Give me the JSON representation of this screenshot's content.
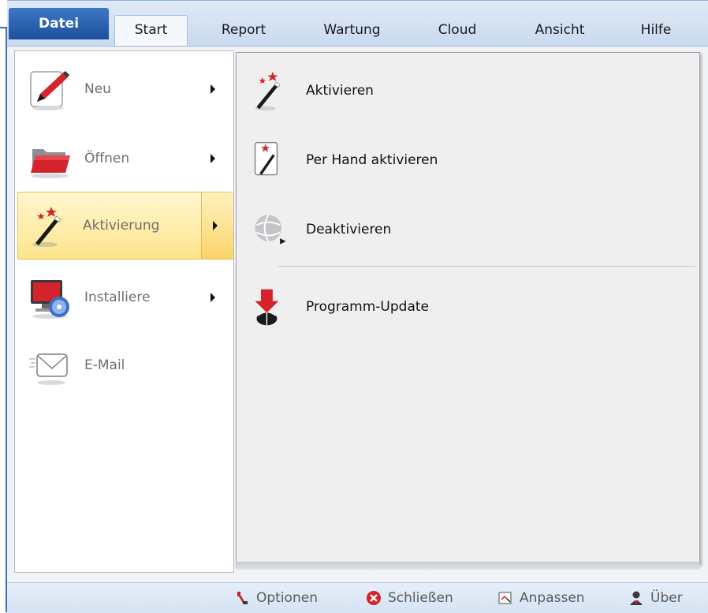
{
  "ribbon": {
    "tabs": [
      {
        "label": "Datei"
      },
      {
        "label": "Start"
      },
      {
        "label": "Report"
      },
      {
        "label": "Wartung"
      },
      {
        "label": "Cloud"
      },
      {
        "label": "Ansicht"
      },
      {
        "label": "Hilfe"
      }
    ]
  },
  "left_menu": {
    "items": [
      {
        "label": "Neu",
        "icon": "pen-icon",
        "submenu": true
      },
      {
        "label": "Öffnen",
        "icon": "folder-icon",
        "submenu": true
      },
      {
        "label": "Aktivierung",
        "icon": "magic-wand-icon",
        "submenu": true,
        "selected": true
      },
      {
        "label": "Installiere",
        "icon": "monitor-disc-icon",
        "submenu": true
      },
      {
        "label": "E-Mail",
        "icon": "envelope-icon",
        "submenu": false
      }
    ]
  },
  "right_menu": {
    "items": [
      {
        "label": "Aktivieren",
        "icon": "magic-wand-icon"
      },
      {
        "label": "Per Hand aktivieren",
        "icon": "wand-card-icon"
      },
      {
        "label": "Deaktivieren",
        "icon": "globe-icon"
      },
      {
        "label": "Programm-Update",
        "icon": "update-arrow-icon"
      }
    ]
  },
  "footer": {
    "optionen": "Optionen",
    "schliessen": "Schließen",
    "anpassen": "Anpassen",
    "uber": "Über"
  },
  "colors": {
    "accent_blue": "#1d4f9c",
    "selection_gold": "#fde48b",
    "icon_red": "#d4232a"
  }
}
